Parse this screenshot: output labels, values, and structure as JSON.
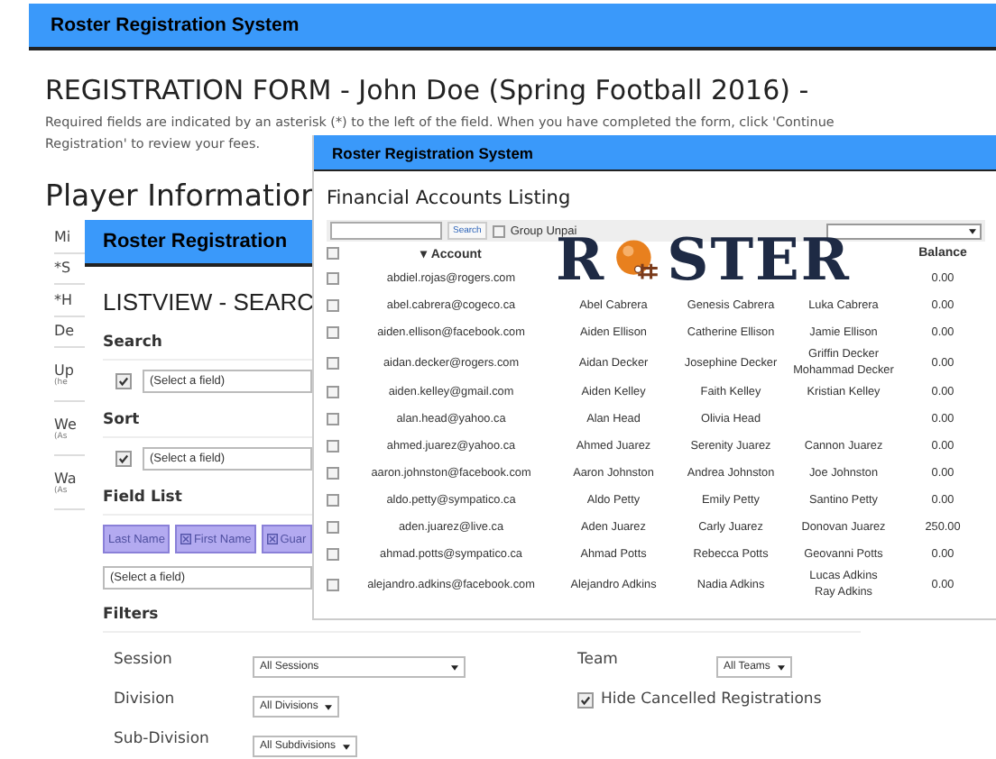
{
  "registration_window": {
    "title": "Roster Registration System",
    "heading": "REGISTRATION FORM - John Doe (Spring Football 2016) -",
    "instructions": [
      "Required fields are indicated by an asterisk (*) to the left of the field. When you have completed the form, click 'Continue",
      "Registration' to review your fees."
    ],
    "section": "Player Information",
    "fields": [
      {
        "label": "Mi"
      },
      {
        "label": "*S"
      },
      {
        "label": "*H"
      },
      {
        "label": "De"
      },
      {
        "label": "Up",
        "hint": "(he"
      },
      {
        "label": "We",
        "hint": "(As"
      },
      {
        "label": "Wa",
        "hint": "(As"
      }
    ]
  },
  "listview_window": {
    "title": "Roster Registration",
    "heading": "LISTVIEW - SEARC",
    "search": {
      "label": "Search",
      "checked": true,
      "select": "(Select a field)"
    },
    "sort": {
      "label": "Sort",
      "checked": true,
      "select": "(Select a field)"
    },
    "field_list": {
      "label": "Field List",
      "chips": [
        {
          "label": "Last Name",
          "removable": false
        },
        {
          "label": "First Name",
          "removable": true
        },
        {
          "label": "Guar",
          "removable": true
        }
      ],
      "select": "(Select a field)"
    },
    "filters": {
      "label": "Filters",
      "session": {
        "label": "Session",
        "value": "All Sessions"
      },
      "team": {
        "label": "Team",
        "value": "All Teams"
      },
      "division": {
        "label": "Division",
        "value": "All Divisions"
      },
      "hide_cancelled": {
        "label": "Hide Cancelled Registrations",
        "checked": true
      },
      "subdivision": {
        "label": "Sub-Division",
        "value": "All Subdivisions"
      }
    }
  },
  "accounts_window": {
    "title": "Roster Registration System",
    "heading": "Financial Accounts Listing",
    "search_button": "Search",
    "group_unpaid": {
      "label": "Group Unpai",
      "checked": false
    },
    "logo": {
      "before": "R",
      "after": "STER"
    },
    "header": {
      "checked": false,
      "sort_indicator": "▾",
      "account": "Account",
      "balance": "Balance"
    },
    "rows": [
      {
        "checked": false,
        "account": "abdiel.rojas@rogers.com",
        "balance": "0.00"
      },
      {
        "checked": false,
        "account": "abel.cabrera@cogeco.ca",
        "primary": "Abel Cabrera",
        "contact": "Genesis Cabrera",
        "players": [
          "Luka Cabrera"
        ],
        "balance": "0.00"
      },
      {
        "checked": false,
        "account": "aiden.ellison@facebook.com",
        "primary": "Aiden Ellison",
        "contact": "Catherine Ellison",
        "players": [
          "Jamie Ellison"
        ],
        "balance": "0.00"
      },
      {
        "checked": false,
        "account": "aidan.decker@rogers.com",
        "primary": "Aidan Decker",
        "contact": "Josephine Decker",
        "players": [
          "Griffin Decker",
          "Mohammad Decker"
        ],
        "balance": "0.00"
      },
      {
        "checked": false,
        "account": "aiden.kelley@gmail.com",
        "primary": "Aiden Kelley",
        "contact": "Faith Kelley",
        "players": [
          "Kristian Kelley"
        ],
        "balance": "0.00"
      },
      {
        "checked": false,
        "account": "alan.head@yahoo.ca",
        "primary": "Alan Head",
        "contact": "Olivia Head",
        "balance": "0.00"
      },
      {
        "checked": false,
        "account": "ahmed.juarez@yahoo.ca",
        "primary": "Ahmed Juarez",
        "contact": "Serenity Juarez",
        "players": [
          "Cannon Juarez"
        ],
        "balance": "0.00"
      },
      {
        "checked": false,
        "account": "aaron.johnston@facebook.com",
        "primary": "Aaron Johnston",
        "contact": "Andrea Johnston",
        "players": [
          "Joe Johnston"
        ],
        "balance": "0.00"
      },
      {
        "checked": false,
        "account": "aldo.petty@sympatico.ca",
        "primary": "Aldo Petty",
        "contact": "Emily Petty",
        "players": [
          "Santino Petty"
        ],
        "balance": "0.00"
      },
      {
        "checked": false,
        "account": "aden.juarez@live.ca",
        "primary": "Aden Juarez",
        "contact": "Carly Juarez",
        "players": [
          "Donovan Juarez"
        ],
        "balance": "250.00"
      },
      {
        "checked": false,
        "account": "ahmad.potts@sympatico.ca",
        "primary": "Ahmad Potts",
        "contact": "Rebecca Potts",
        "players": [
          "Geovanni Potts"
        ],
        "balance": "0.00"
      },
      {
        "checked": false,
        "account": "alejandro.adkins@facebook.com",
        "primary": "Alejandro Adkins",
        "contact": "Nadia Adkins",
        "players": [
          "Lucas Adkins",
          "Ray Adkins"
        ],
        "balance": "0.00"
      }
    ]
  }
}
